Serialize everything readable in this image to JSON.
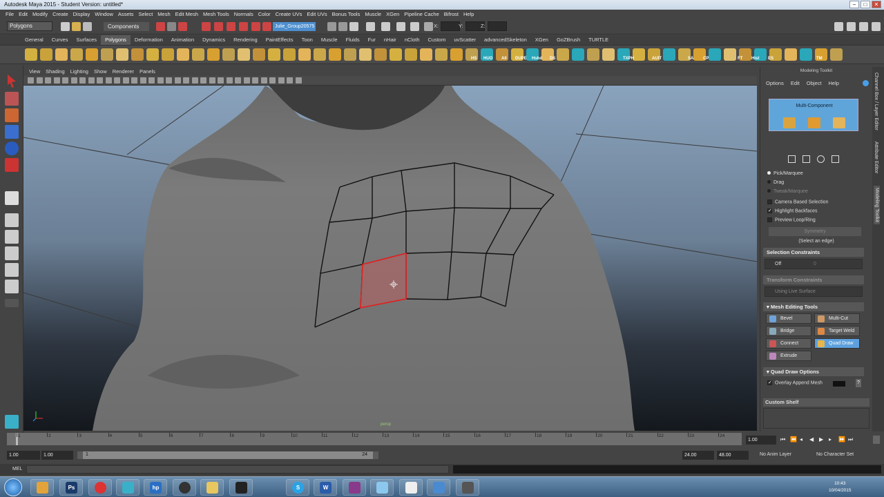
{
  "window": {
    "title": "Autodesk Maya 2015 - Student Version: untitled*",
    "buttons": [
      "–",
      "□",
      "✕"
    ]
  },
  "menubar": {
    "items": [
      "File",
      "Edit",
      "Modify",
      "Create",
      "Display",
      "Window",
      "Assets",
      "Select",
      "Mesh",
      "Edit Mesh",
      "Mesh Tools",
      "Normals",
      "Color",
      "Create UVs",
      "Edit UVs",
      "Bonus Tools",
      "Muscle",
      "XGen",
      "Pipeline Cache",
      "Bifrost",
      "Help"
    ]
  },
  "statusline": {
    "mode": "Polygons",
    "components": "Components",
    "group": "Julie_Group20575",
    "x_label": "X:",
    "y_label": "Y:",
    "z_label": "Z:"
  },
  "shelf": {
    "tabs": [
      "General",
      "Curves",
      "Surfaces",
      "Polygons",
      "Deformation",
      "Animation",
      "Dynamics",
      "Rendering",
      "PaintEffects",
      "Toon",
      "Muscle",
      "Fluids",
      "Fur",
      "nHair",
      "nCloth",
      "Custom",
      "uvScatter",
      "advancedSkeleton",
      "XGen",
      "GoZBrush",
      "TURTLE"
    ],
    "active_tab": "Polygons",
    "icon_labels": [
      "HS",
      "HUO",
      "All",
      "DUPE",
      "Hshd",
      "DS",
      "TXPH",
      "AUIT",
      "SA",
      "CP",
      "FT",
      "Hist",
      "ES",
      "TM"
    ]
  },
  "viewport": {
    "menu": [
      "View",
      "Shading",
      "Lighting",
      "Show",
      "Renderer",
      "Panels"
    ],
    "camera": "persp"
  },
  "modeling_toolkit": {
    "title": "Modeling Toolkit",
    "menu": [
      "Options",
      "Edit",
      "Object",
      "Help"
    ],
    "multi_component": "Multi-Component",
    "pick_marquee": "Pick/Marquee",
    "drag": "Drag",
    "tweak_marquee": "Tweak/Marquee",
    "camera_based": "Camera Based Selection",
    "highlight_backfaces": "Highlight Backfaces",
    "preview_loop": "Preview Loop/Ring",
    "symmetry": "Symmetry",
    "select_edge": "(Select an edge)",
    "selection_constraints": "Selection Constraints",
    "sel_value": "Off",
    "sel_num": "0",
    "transform_constraints": "Transform Constraints",
    "live_surface": "Using Live Surface",
    "mesh_editing_tools": "Mesh Editing Tools",
    "tools": [
      "Bevel",
      "Multi-Cut",
      "Bridge",
      "Target Weld",
      "Connect",
      "Quad Draw",
      "Extrude"
    ],
    "active_tool": "Quad Draw",
    "quad_draw_options": "Quad Draw Options",
    "overlay_append": "Overlay Append Mesh",
    "custom_shelf": "Custom Shelf"
  },
  "side_tabs": [
    "Channel Box / Layer Editor",
    "Attribute Editor",
    "Modeling Toolkit"
  ],
  "timeline": {
    "ticks": [
      "1",
      "2",
      "3",
      "4",
      "5",
      "6",
      "7",
      "8",
      "9",
      "10",
      "11",
      "12",
      "13",
      "14",
      "15",
      "16",
      "17",
      "18",
      "19",
      "20",
      "21",
      "22",
      "23",
      "24"
    ],
    "current": "1.00"
  },
  "range": {
    "start": "1.00",
    "start2": "1.00",
    "slider_start": "1",
    "slider_end": "24",
    "end": "24.00",
    "end2": "48.00",
    "anim_layer": "No Anim Layer",
    "character": "No Character Set"
  },
  "mel": {
    "label": "MEL"
  },
  "taskbar": {
    "time": "10:43",
    "date": "10/04/2015"
  },
  "colors": {
    "accent": "#5da0dd",
    "selection": "#e82020",
    "wire": "#111111"
  }
}
